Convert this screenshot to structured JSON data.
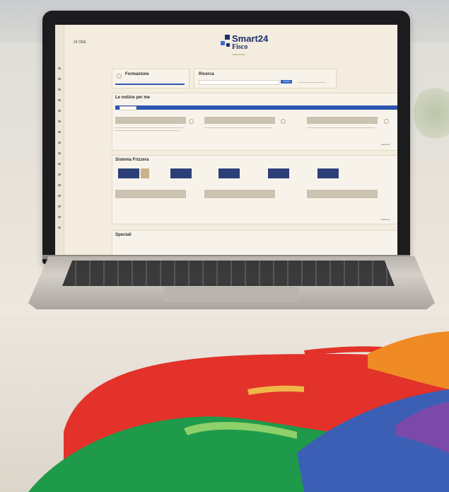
{
  "screen": {
    "brand_small": "24 ORE",
    "logo": {
      "line1": "Smart24",
      "line2": "Fisco",
      "tagline": "Il Sole 24 Ore"
    },
    "colors": {
      "navy": "#1d2f6b",
      "blue": "#2e56b0",
      "accent_red": "#e2322a",
      "accent_green": "#1f9a4a",
      "accent_orange": "#f08a24"
    },
    "cards": {
      "formazione": {
        "title": "Formazione"
      },
      "ricerca": {
        "title": "Ricerca",
        "button": "Cerca"
      },
      "notizie": {
        "title": "Le notizie per me"
      },
      "sistema": {
        "title": "Sistema Frizzera"
      },
      "speciali": {
        "title": "Speciali"
      }
    },
    "more_label": "Vedi tutto"
  }
}
